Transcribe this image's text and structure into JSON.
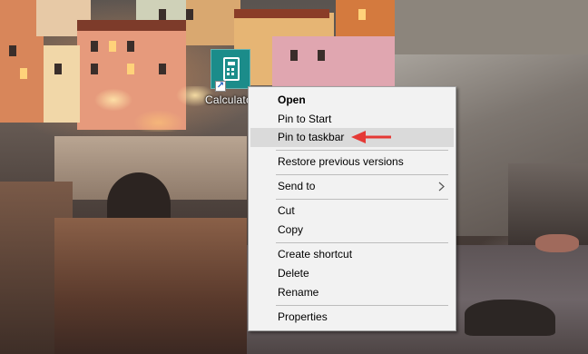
{
  "desktop": {
    "icon_label": "Calculator",
    "icon_name": "calculator-icon"
  },
  "context_menu": {
    "items": [
      {
        "label": "Open",
        "bold": true
      },
      {
        "label": "Pin to Start"
      },
      {
        "label": "Pin to taskbar",
        "highlighted": true
      },
      {
        "label": "Restore previous versions"
      },
      {
        "label": "Send to",
        "submenu": true
      },
      {
        "label": "Cut"
      },
      {
        "label": "Copy"
      },
      {
        "label": "Create shortcut"
      },
      {
        "label": "Delete"
      },
      {
        "label": "Rename"
      },
      {
        "label": "Properties"
      }
    ]
  },
  "annotation": {
    "arrow_color": "#e53935"
  },
  "colors": {
    "menu_background": "#f2f2f2",
    "menu_highlight": "#dadada",
    "tile_color": "#1b8c8a"
  }
}
